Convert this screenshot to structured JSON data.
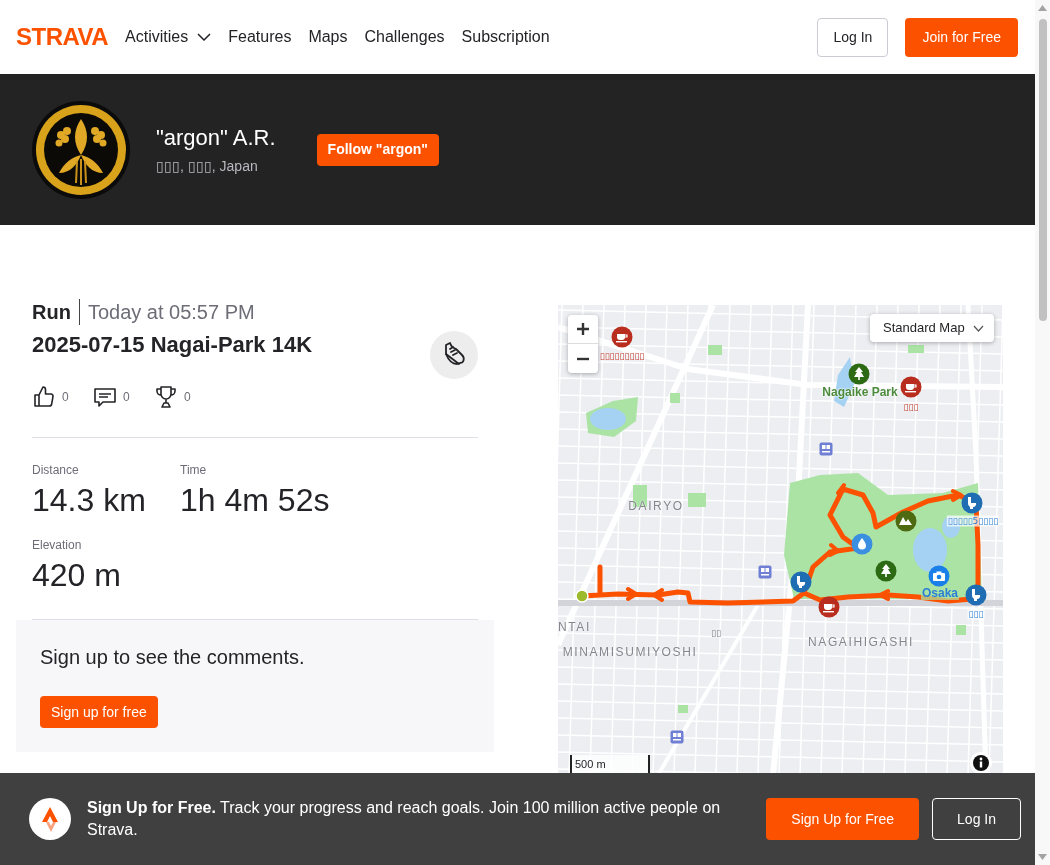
{
  "header": {
    "logo": "STRAVA",
    "nav": [
      {
        "label": "Activities",
        "dropdown": true
      },
      {
        "label": "Features",
        "dropdown": false
      },
      {
        "label": "Maps",
        "dropdown": false
      },
      {
        "label": "Challenges",
        "dropdown": false
      },
      {
        "label": "Subscription",
        "dropdown": false
      }
    ],
    "buttons": [
      {
        "label": "Log In",
        "kind": "outline"
      },
      {
        "label": "Join for Free",
        "kind": "primary"
      }
    ]
  },
  "profile": {
    "name": "\"argon\" A.R.",
    "location": "▯▯▯, ▯▯▯, Japan",
    "follow_button": "Follow \"argon\""
  },
  "activity": {
    "sport": "Run",
    "time": "Today at 05:57 PM",
    "title": "2025-07-15 Nagai-Park 14K",
    "social": [
      {
        "kind": "kudos",
        "count": "0"
      },
      {
        "kind": "comments",
        "count": "0"
      },
      {
        "kind": "achievements",
        "count": "0"
      }
    ],
    "stats": [
      {
        "label": "Distance",
        "value": "14.3 km"
      },
      {
        "label": "Time",
        "value": "1h 4m 52s"
      },
      {
        "label": "Elevation",
        "value": "420 m"
      }
    ]
  },
  "comments": {
    "message": "Sign up to see the comments.",
    "button": "Sign up for free"
  },
  "map": {
    "map_type": "Standard Map",
    "scale": "500 m",
    "labels": [
      {
        "text": "▯▯▯▯▯▯▯▯▯",
        "kind": "cafe"
      },
      {
        "text": "Nagaike Park",
        "kind": "park"
      },
      {
        "text": "▯▯▯",
        "kind": "cafe"
      },
      {
        "text": "DAIRYO",
        "kind": "district"
      },
      {
        "text": "▯▯▯▯▯5▯▯▯▯",
        "kind": "facility"
      },
      {
        "text": "Osaka",
        "kind": "place"
      },
      {
        "text": "▯▯▯",
        "kind": "facility"
      },
      {
        "text": "NTAI",
        "kind": "district"
      },
      {
        "text": "▯▯",
        "kind": "local"
      },
      {
        "text": "MINAMISUMIYOSHI",
        "kind": "district"
      },
      {
        "text": "NAGAIHIGASHI",
        "kind": "district"
      }
    ],
    "markers": [
      {
        "kind": "cafe"
      },
      {
        "kind": "tree"
      },
      {
        "kind": "cafe"
      },
      {
        "kind": "station"
      },
      {
        "kind": "toilet"
      },
      {
        "kind": "mountain"
      },
      {
        "kind": "water"
      },
      {
        "kind": "station"
      },
      {
        "kind": "tree"
      },
      {
        "kind": "camera"
      },
      {
        "kind": "toilet"
      },
      {
        "kind": "toilet"
      },
      {
        "kind": "cafe"
      },
      {
        "kind": "station"
      },
      {
        "kind": "start"
      }
    ]
  },
  "signup_bar": {
    "message": "**Sign Up for Free.** Track your progress and reach goals. Join 100 million active people on Strava.",
    "buttons": [
      {
        "label": "Sign Up for Free",
        "kind": "primary"
      },
      {
        "label": "Log In",
        "kind": "outline"
      }
    ]
  }
}
